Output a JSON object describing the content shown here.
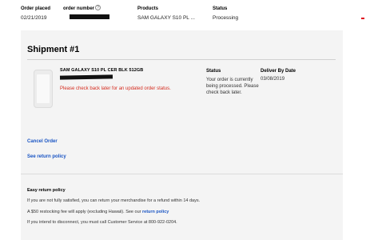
{
  "order_header": {
    "order_placed_label": "Order placed",
    "order_placed_value": "02/21/2019",
    "order_number_label": "order number",
    "products_label": "Products",
    "products_value": "SAM GALAXY S10 PL ...",
    "status_label": "Status",
    "status_value": "Processing"
  },
  "shipment": {
    "title": "Shipment #1",
    "product_name": "SAM GALAXY S10 PL CER BLK 512GB",
    "product_message": "Please check back later for an updated order status.",
    "status_heading": "Status",
    "status_text": "Your order is currently being processed. Please check back later.",
    "deliver_heading": "Deliver By Date",
    "deliver_date": "03/08/2019",
    "cancel_order": "Cancel Order",
    "see_return_policy": "See return policy"
  },
  "easy_return": {
    "heading": "Easy return policy",
    "line1": "If you are not fully satisfied, you can return your merchandise for a refund within 14 days.",
    "line2_prefix": "A $50 restocking fee will apply (excluding Hawaii). See our",
    "line2_link": "return policy",
    "line3": "If you intend to disconnect, you must call Customer Service at 800-922-0204."
  },
  "colors": {
    "accent_red": "#d52b1e",
    "link_blue": "#1a55c4",
    "panel_bg": "#f4f4f4"
  }
}
